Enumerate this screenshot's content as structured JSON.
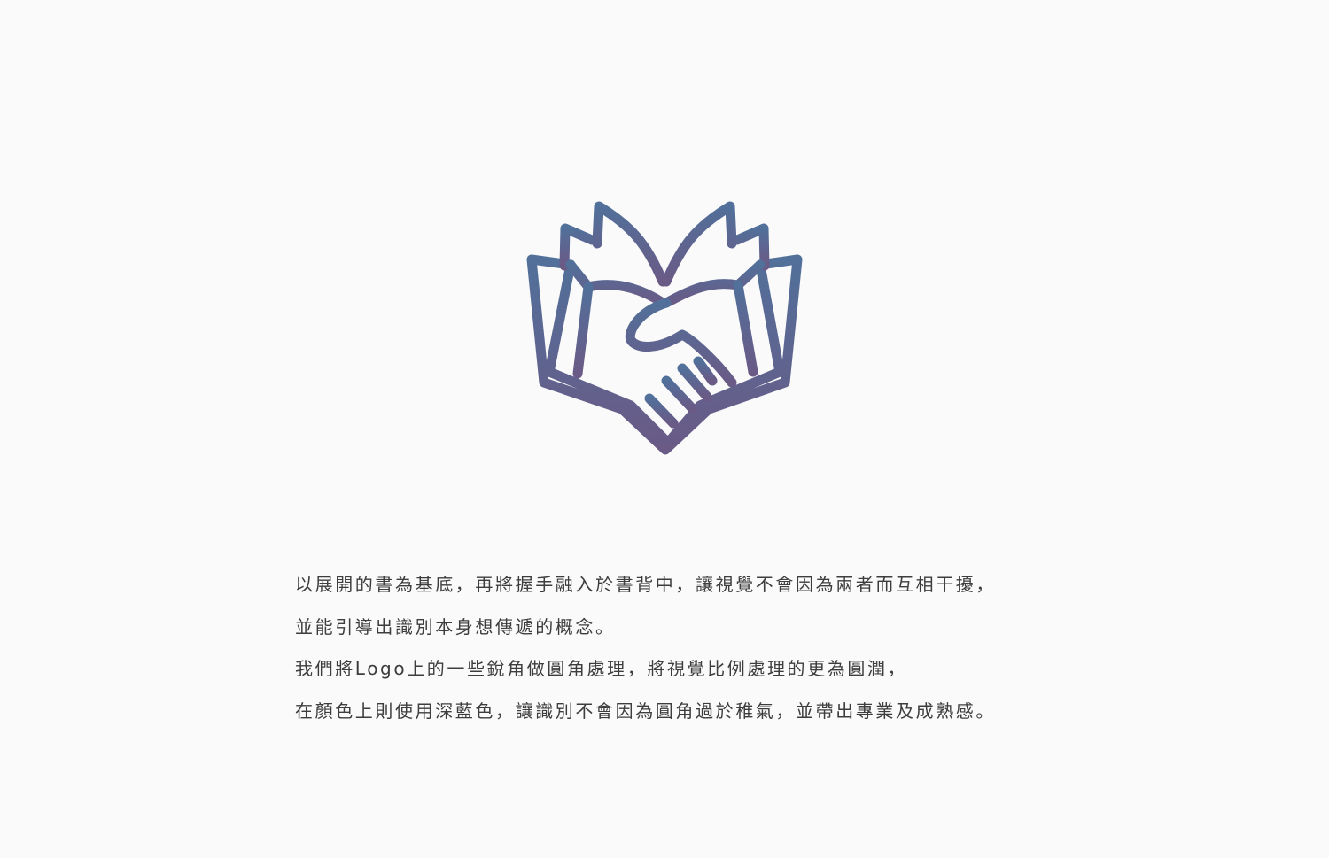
{
  "colors": {
    "background": "#fafafa",
    "logo_gradient_top": "#51709a",
    "logo_gradient_bottom": "#6a5a86",
    "text": "#3d3d3d"
  },
  "logo": {
    "icon": "book-handshake-icon"
  },
  "description": {
    "lines": [
      "以展開的書為基底，再將握手融入於書背中，讓視覺不會因為兩者而互相干擾，",
      "並能引導出識別本身想傳遞的概念。",
      "我們將Logo上的一些銳角做圓角處理，將視覺比例處理的更為圓潤，",
      "在顏色上則使用深藍色，讓識別不會因為圓角過於稚氣，並帶出專業及成熟感。"
    ]
  }
}
